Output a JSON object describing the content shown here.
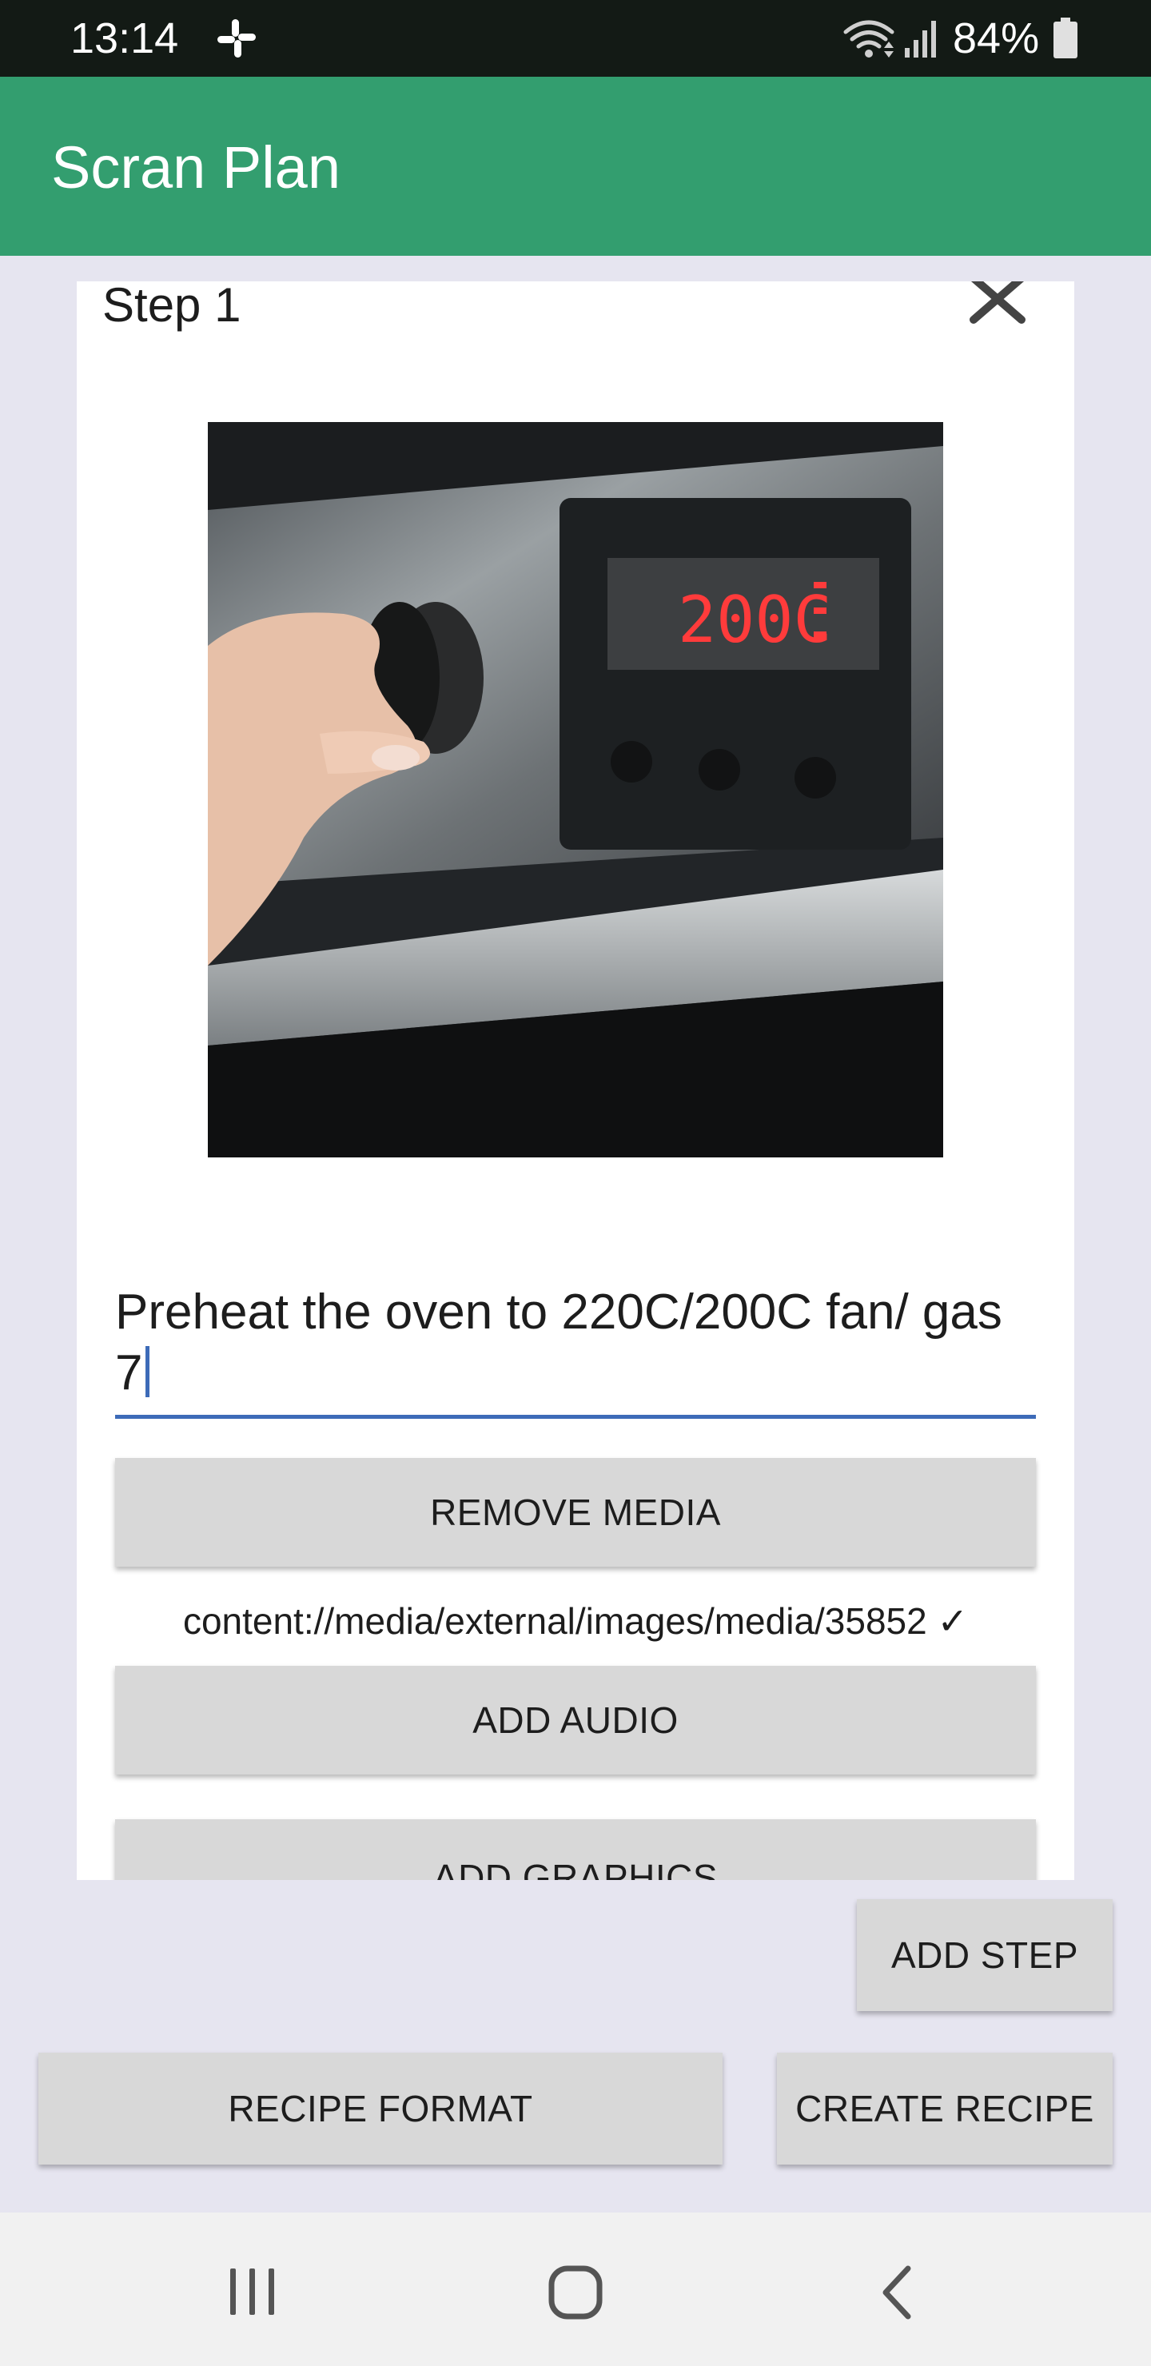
{
  "status_bar": {
    "time": "13:14",
    "battery": "84%",
    "icons": [
      "slack-icon",
      "wifi-icon",
      "signal-icon",
      "battery-icon"
    ]
  },
  "app_bar": {
    "title": "Scran Plan",
    "color": "#339e6f"
  },
  "step": {
    "title": "Step 1",
    "image_alt": "hand turning oven dial, display reading 200C",
    "oven_display": "200C",
    "description": "Preheat the oven to 220C/200C fan/ gas 7",
    "media_path": "content://media/external/images/media/35852 ✓"
  },
  "buttons": {
    "remove_media": "REMOVE MEDIA",
    "add_audio": "ADD AUDIO",
    "add_graphics": "ADD GRAPHICS",
    "add_step": "ADD STEP",
    "recipe_format": "RECIPE FORMAT",
    "create_recipe": "CREATE RECIPE"
  },
  "nav": {
    "icons": [
      "recent-apps-icon",
      "home-icon",
      "back-icon"
    ]
  },
  "colors": {
    "background": "#e6e5f0",
    "button": "#d8d8d8",
    "input_underline": "#3d6bb8",
    "status_bar": "#131a15"
  }
}
